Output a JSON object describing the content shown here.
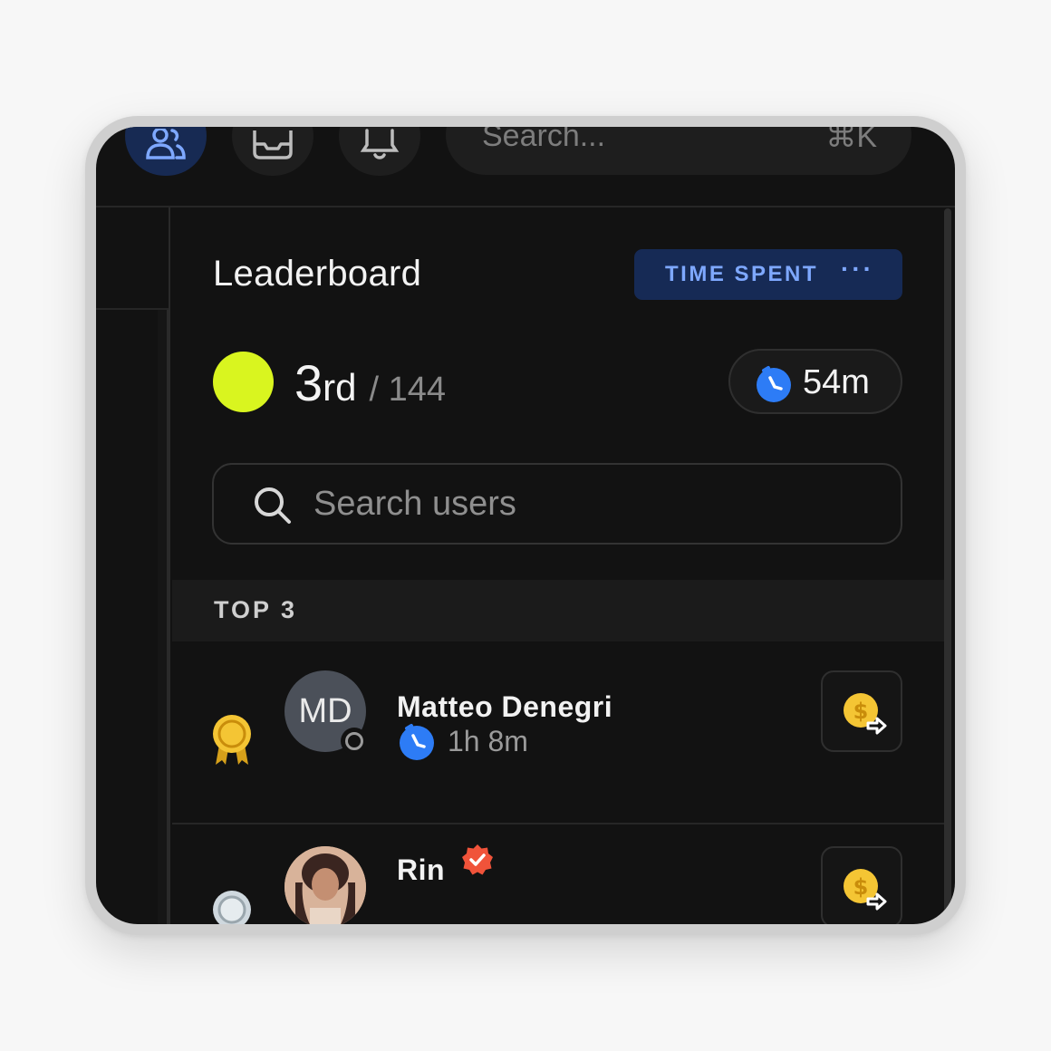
{
  "topbar": {
    "search_placeholder": "Search...",
    "search_shortcut": "⌘K",
    "icons": [
      "users-icon",
      "inbox-icon",
      "bell-icon"
    ]
  },
  "leaderboard": {
    "title": "Leaderboard",
    "metric_button": "TIME SPENT",
    "more": "···",
    "my_rank": {
      "number": "3",
      "suffix": "rd",
      "total": "/ 144",
      "time": "54m"
    },
    "search_placeholder": "Search users",
    "section_label": "TOP 3",
    "entries": [
      {
        "name": "Matteo Denegri",
        "initials": "MD",
        "time": "1h 8m",
        "medal": "gold",
        "status": "offline"
      },
      {
        "name": "Rin",
        "verified": true,
        "medal": "silver"
      }
    ]
  },
  "colors": {
    "accent": "#7ea8ff",
    "accent_bg": "#162a55",
    "rank_dot": "#d9f51f",
    "gold": "#f4c534",
    "verified": "#f0533a",
    "timer": "#2d7cf6"
  }
}
